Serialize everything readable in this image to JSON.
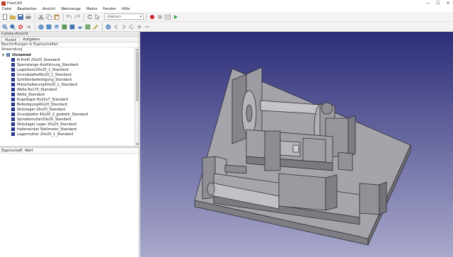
{
  "window": {
    "title": "FreeCAD"
  },
  "titlebar": {
    "minimize": "—",
    "maximize": "☐",
    "close": "✕"
  },
  "menu": {
    "items": [
      "Datei",
      "Bearbeiten",
      "Ansicht",
      "Werkzeuge",
      "Makro",
      "Fenster",
      "Hilfe"
    ]
  },
  "toolbar1": {
    "workbench": "<keine>",
    "icons": [
      "new-document-icon",
      "open-icon",
      "save-icon",
      "print-icon",
      "cut-icon",
      "copy-icon",
      "paste-icon",
      "undo-icon",
      "redo-icon",
      "refresh-icon",
      "whats-this-icon",
      "record-macro-icon",
      "stop-macro-icon",
      "macros-icon",
      "execute-macro-icon"
    ]
  },
  "toolbar2": {
    "icons": [
      "fit-all-icon",
      "fit-selection-icon",
      "draw-style-icon",
      "sync-view-icon",
      "isometric-icon",
      "front-view-icon",
      "top-view-icon",
      "right-view-icon",
      "rear-view-icon",
      "bottom-view-icon",
      "left-view-icon",
      "measure-icon",
      "web-home-icon",
      "back-icon",
      "forward-icon",
      "refresh-web-icon",
      "zoom-in-icon",
      "zoom-out-icon"
    ]
  },
  "panel": {
    "title": "Combo-Ansicht",
    "tabs": [
      "Modell",
      "Aufgaben"
    ],
    "labels_header": "Beschriftungen & Eigenschaften",
    "group": "Anwendung",
    "root": "Unnamed",
    "items": [
      "N-Profil 20x20_Standard",
      "Sperrstange Ausführung_Standard",
      "Lagerbock20x20_1_Standard",
      "Grundplatte40x20_1_Standard",
      "Schlittenbefestigung_Standard",
      "Motorhalterung40x20_1_Standard",
      "Welle 8x170_Standard",
      "Welle_Standard",
      "Kugellager 8x22x7_Standard",
      "Befestigung40x20_Standard",
      "Stützlager 20x20_Standard",
      "Grundplatte 40x20_2_gedreht_Standard",
      "Spindelmutter20x20_Standard",
      "Stützlager Lager 20x20_Standard",
      "Halterwinkel Stellmotor_Standard",
      "Lagermutter 20x20_1_Standard"
    ],
    "prop_col1": "Eigenschaft",
    "prop_col2": "Wert"
  },
  "colors": {
    "viewport_top": "#2c2d78",
    "viewport_bottom": "#a9a9cc",
    "model_gray": "#9a9a9f",
    "model_edge": "#2f2f35",
    "tree_square": "#2a3fa8"
  }
}
